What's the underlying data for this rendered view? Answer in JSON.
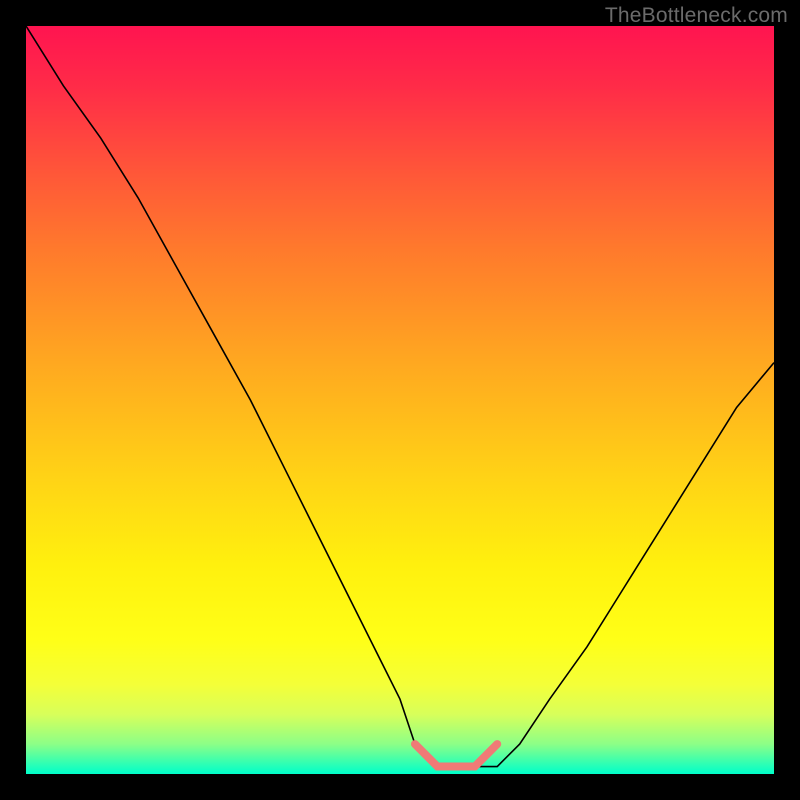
{
  "watermark": {
    "text": "TheBottleneck.com"
  },
  "chart_data": {
    "type": "line",
    "title": "",
    "xlabel": "",
    "ylabel": "",
    "x_range": [
      0,
      100
    ],
    "y_range": [
      0,
      100
    ],
    "series": [
      {
        "name": "curve",
        "color": "#000000",
        "width": 1.6,
        "x": [
          0,
          5,
          10,
          15,
          20,
          25,
          30,
          35,
          40,
          45,
          50,
          52,
          55,
          58,
          60,
          63,
          66,
          70,
          75,
          80,
          85,
          90,
          95,
          100
        ],
        "values": [
          100,
          92,
          85,
          77,
          68,
          59,
          50,
          40,
          30,
          20,
          10,
          4,
          1,
          1,
          1,
          1,
          4,
          10,
          17,
          25,
          33,
          41,
          49,
          55
        ]
      },
      {
        "name": "flat-zone",
        "color": "#f07a76",
        "width": 8,
        "cap": "round",
        "x": [
          52,
          55,
          58,
          60,
          63
        ],
        "values": [
          4,
          1,
          1,
          1,
          4
        ]
      }
    ],
    "gradient_stops": [
      {
        "pos": 0,
        "color": "#ff1450"
      },
      {
        "pos": 8,
        "color": "#ff2b48"
      },
      {
        "pos": 20,
        "color": "#ff5838"
      },
      {
        "pos": 30,
        "color": "#ff7a2c"
      },
      {
        "pos": 45,
        "color": "#ffa820"
      },
      {
        "pos": 60,
        "color": "#ffd216"
      },
      {
        "pos": 72,
        "color": "#fff00e"
      },
      {
        "pos": 82,
        "color": "#ffff17"
      },
      {
        "pos": 88,
        "color": "#f4ff38"
      },
      {
        "pos": 92,
        "color": "#d8ff5a"
      },
      {
        "pos": 96,
        "color": "#8cff87"
      },
      {
        "pos": 99,
        "color": "#22ffba"
      },
      {
        "pos": 100,
        "color": "#00ffca"
      }
    ]
  }
}
